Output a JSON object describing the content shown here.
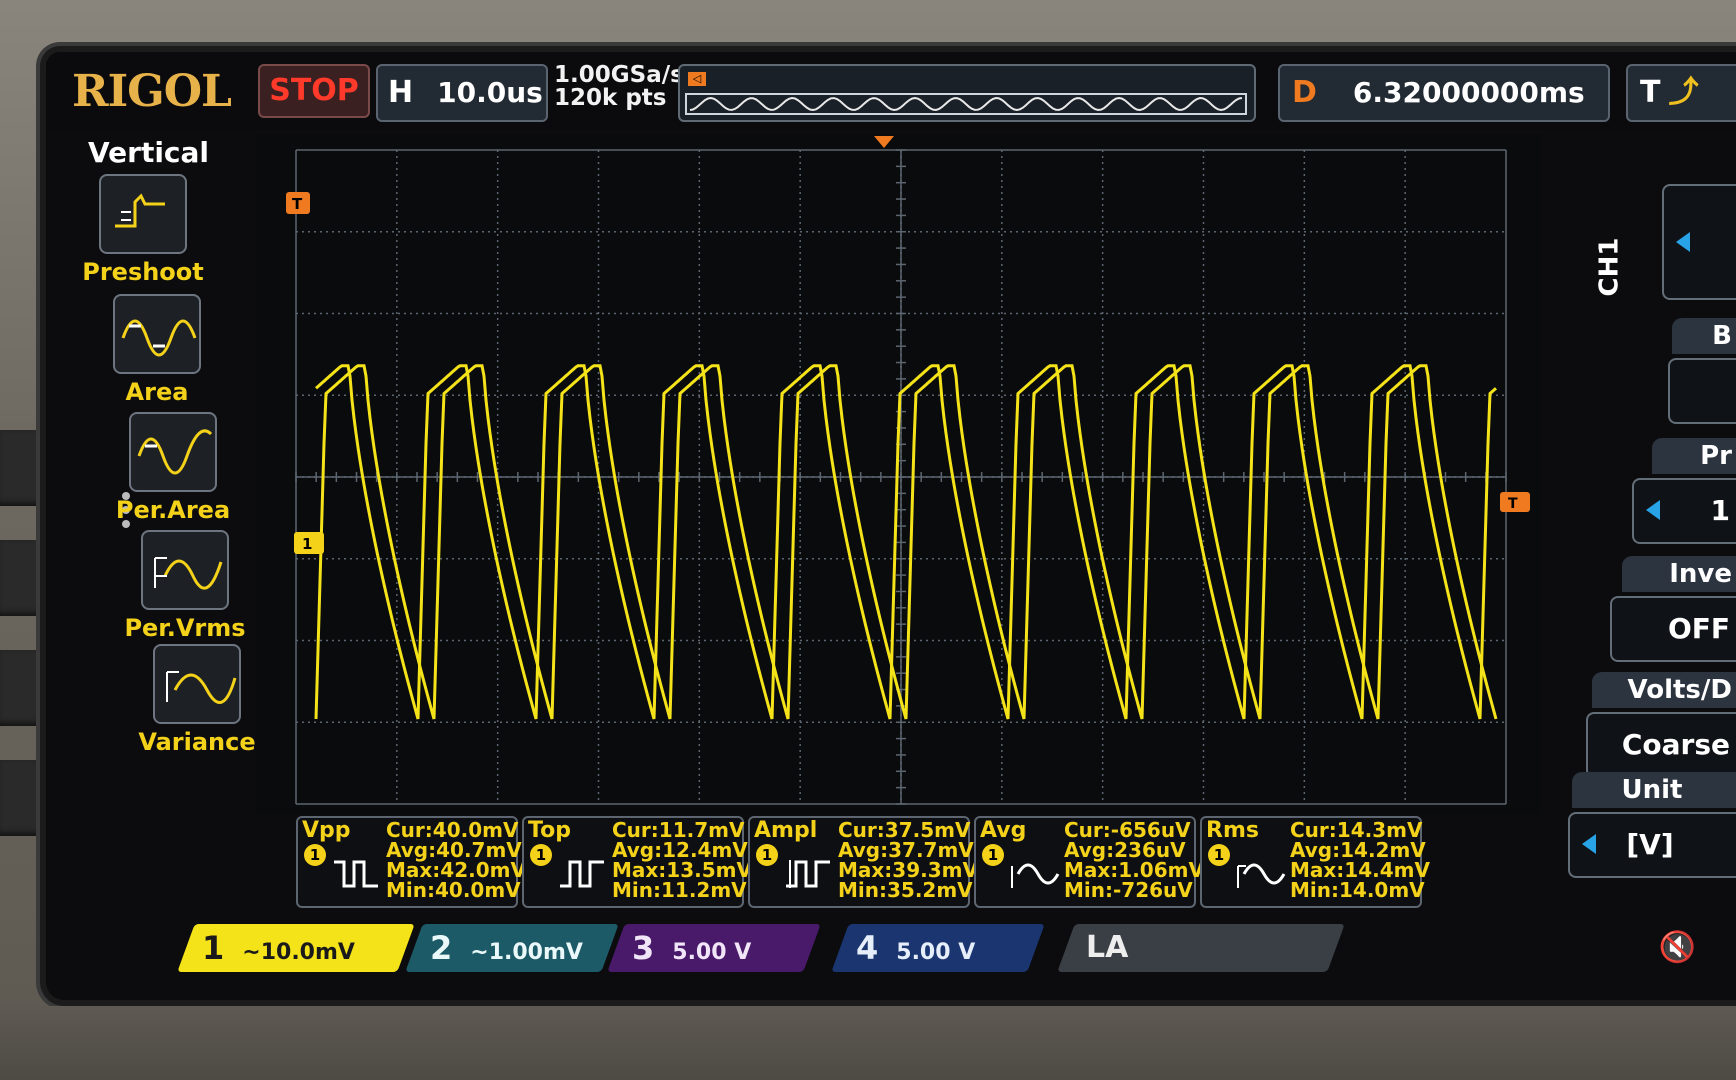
{
  "topbar": {
    "brand": "RIGOL",
    "run_state": "STOP",
    "timebase_label": "H",
    "timebase_value": "10.0us",
    "sample_rate": "1.00GSa/s",
    "memory_depth": "120k pts",
    "delay_label": "D",
    "delay_value": "6.32000000ms",
    "trigger_label": "T"
  },
  "left_menu": {
    "title": "Vertical",
    "items": [
      {
        "label": "Preshoot",
        "icon": "preshoot-icon"
      },
      {
        "label": "Area",
        "icon": "area-icon"
      },
      {
        "label": "Per.Area",
        "icon": "period-area-icon"
      },
      {
        "label": "Per.Vrms",
        "icon": "period-vrms-icon"
      },
      {
        "label": "Variance",
        "icon": "variance-icon"
      }
    ]
  },
  "right_menu": {
    "channel": "CH1",
    "items": [
      {
        "title": "B",
        "value": "",
        "arrow": false
      },
      {
        "title": "Pr",
        "value": "1",
        "arrow": true
      },
      {
        "title": "Inve",
        "value": "OFF",
        "arrow": false
      },
      {
        "title": "Volts/D",
        "value": "Coarse",
        "arrow": false
      },
      {
        "title": "Unit",
        "value": "[V]",
        "arrow": true
      }
    ]
  },
  "measurements": [
    {
      "name": "Vpp",
      "channel": "1",
      "cur": "Cur:40.0mV",
      "avg": "Avg:40.7mV",
      "max": "Max:42.0mV",
      "min": "Min:40.0mV"
    },
    {
      "name": "Top",
      "channel": "1",
      "cur": "Cur:11.7mV",
      "avg": "Avg:12.4mV",
      "max": "Max:13.5mV",
      "min": "Min:11.2mV"
    },
    {
      "name": "Ampl",
      "channel": "1",
      "cur": "Cur:37.5mV",
      "avg": "Avg:37.7mV",
      "max": "Max:39.3mV",
      "min": "Min:35.2mV"
    },
    {
      "name": "Avg",
      "channel": "1",
      "cur": "Cur:-656uV",
      "avg": "Avg:236uV",
      "max": "Max:1.06mV",
      "min": "Min:-726uV"
    },
    {
      "name": "Rms",
      "channel": "1",
      "cur": "Cur:14.3mV",
      "avg": "Avg:14.2mV",
      "max": "Max:14.4mV",
      "min": "Min:14.0mV"
    }
  ],
  "channels": [
    {
      "num": "1",
      "scale": "~10.0mV",
      "color": "#f5e31a"
    },
    {
      "num": "2",
      "scale": "~1.00mV",
      "color": "#20b8c8"
    },
    {
      "num": "3",
      "scale": "5.00 V",
      "color": "#9a30d0"
    },
    {
      "num": "4",
      "scale": "5.00 V",
      "color": "#2060d8"
    }
  ],
  "la_label": "LA",
  "colors": {
    "ch1": "#f5e31a",
    "grid": "#5c6670",
    "brand": "#e7b24a",
    "stop": "#ff3a2a",
    "trigger": "#f07a20"
  },
  "waveform": {
    "cycles": 10,
    "level_high": 0.33,
    "level_low": 0.87
  }
}
